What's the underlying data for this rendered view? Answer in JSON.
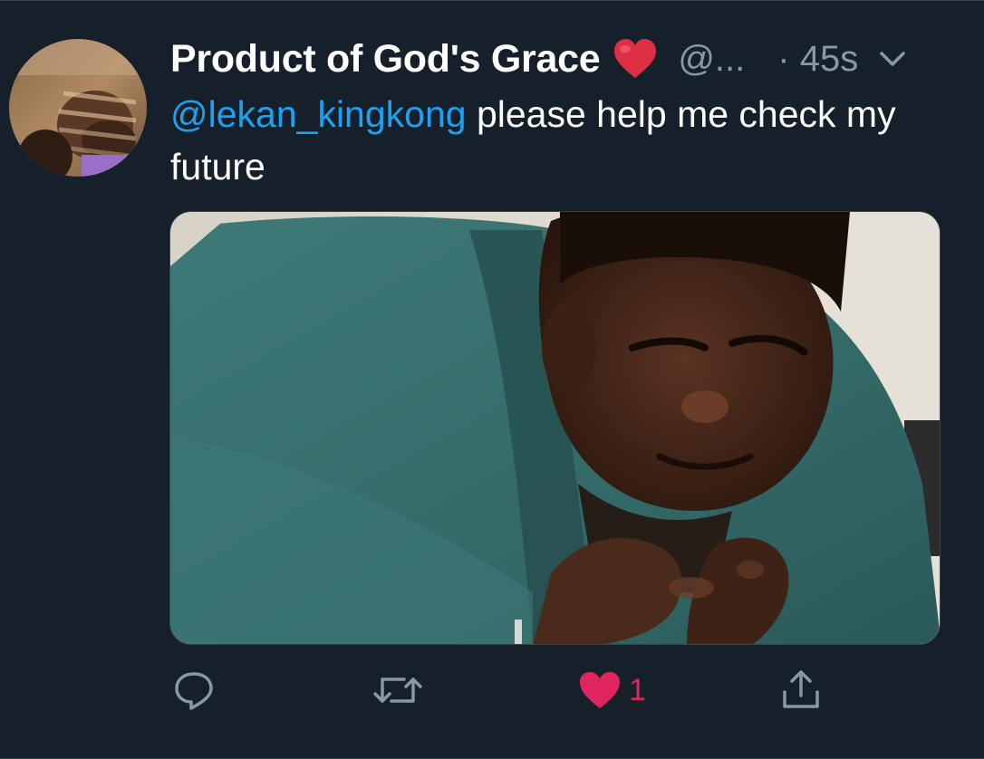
{
  "tweet": {
    "display_name": "Product of God's Grace",
    "handle": "@...",
    "timestamp": "· 45s",
    "mention": "@lekan_kingkong",
    "text": " please help me check my future",
    "heart_emoji_color": "#dd2e44",
    "mention_color": "#1da1f2"
  },
  "actions": {
    "like_count": "1",
    "like_color": "#e0245e",
    "icon_color": "#8899a6",
    "icons": [
      "reply-icon",
      "retweet-icon",
      "like-icon",
      "share-icon"
    ]
  },
  "theme": {
    "background": "#15202b",
    "border": "#38444d"
  }
}
